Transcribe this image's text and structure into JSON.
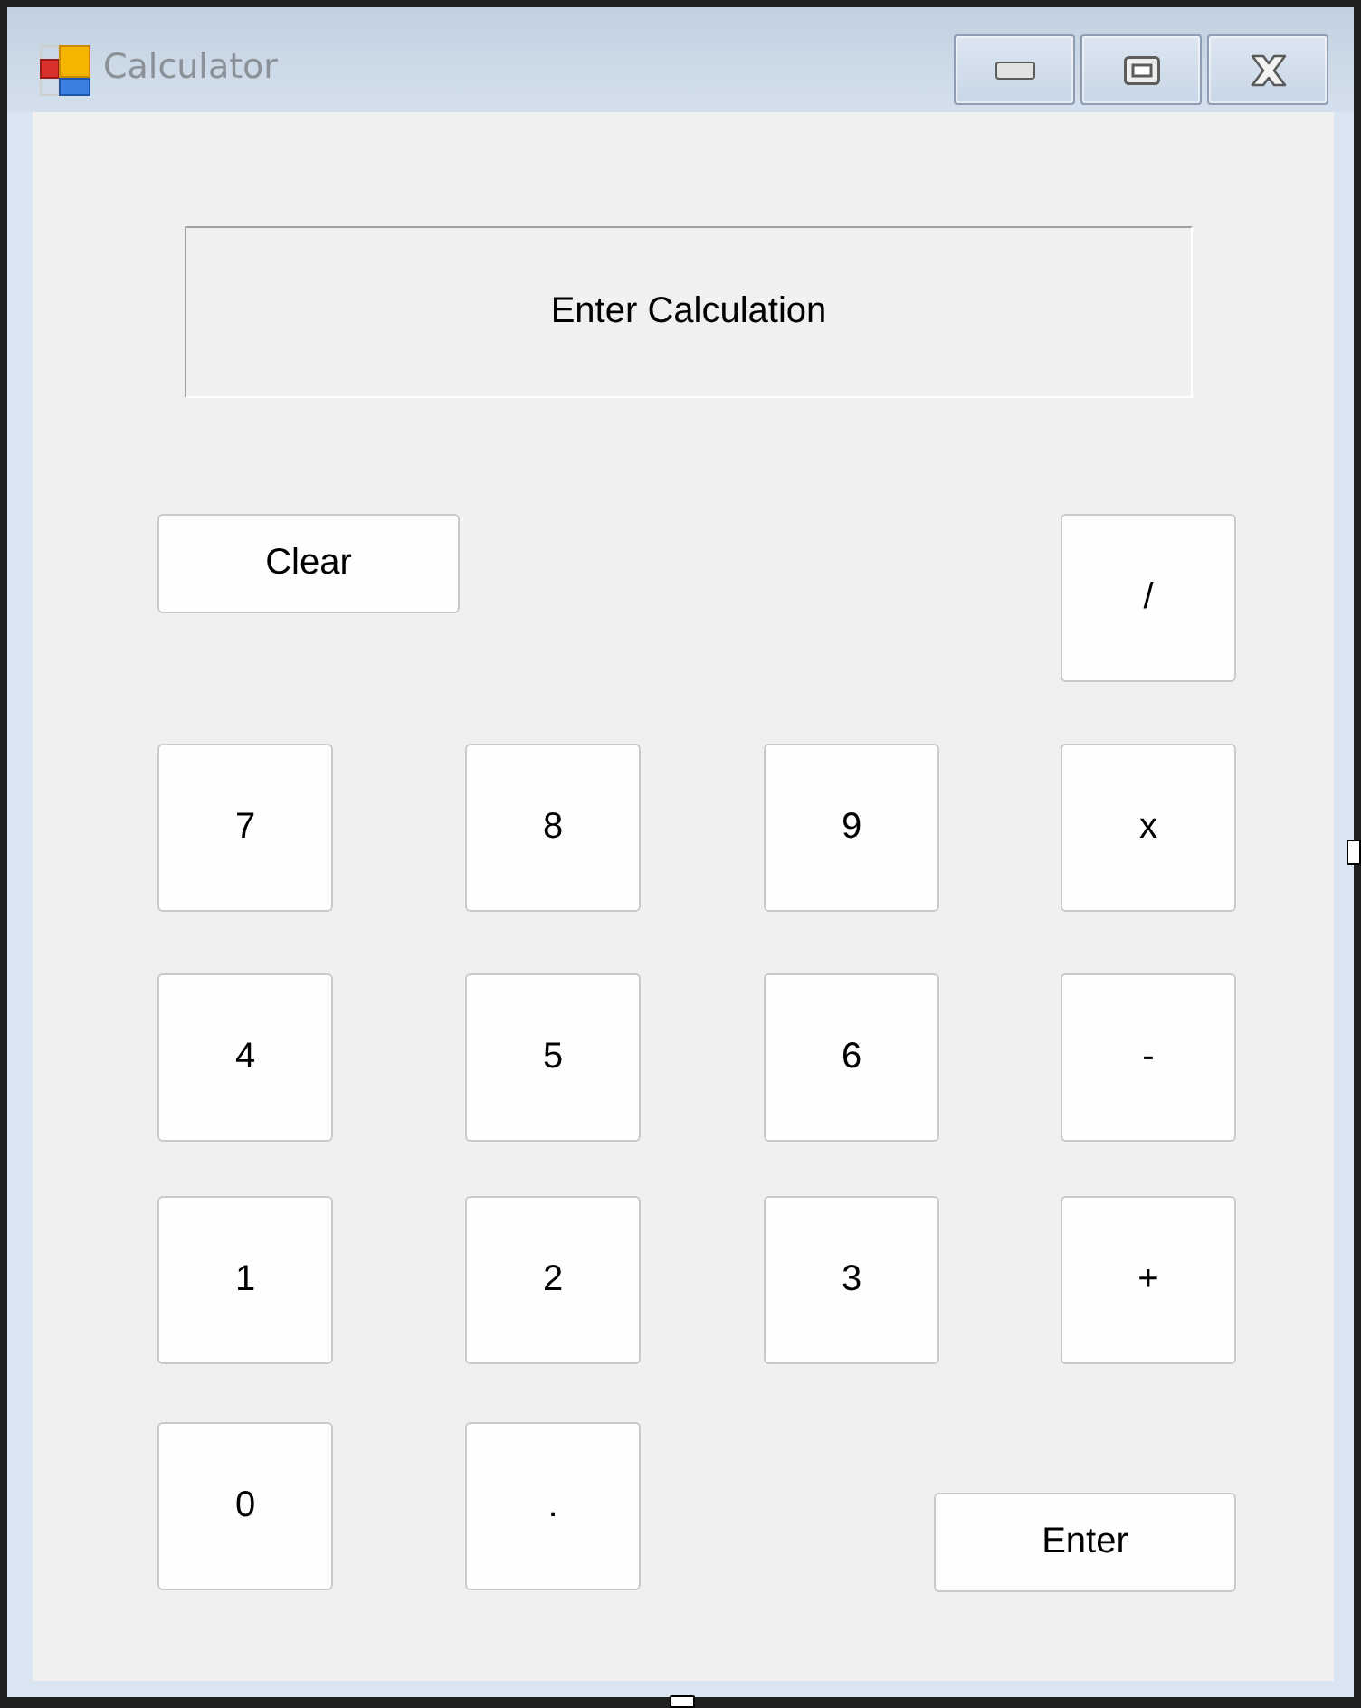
{
  "window": {
    "title": "Calculator"
  },
  "display": {
    "text": "Enter Calculation"
  },
  "buttons": [
    "Clear",
    "/",
    "7",
    "8",
    "9",
    "x",
    "4",
    "5",
    "6",
    "-",
    "1",
    "2",
    "3",
    "+",
    "0",
    ".",
    "Enter"
  ]
}
